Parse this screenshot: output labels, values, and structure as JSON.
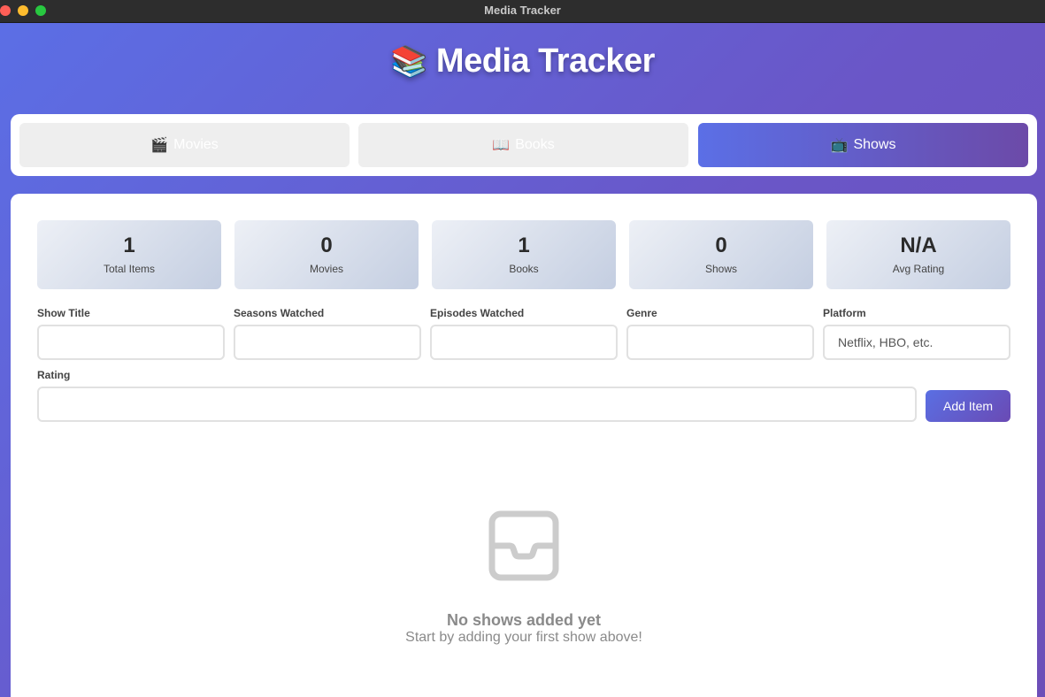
{
  "window": {
    "title": "Media Tracker"
  },
  "header": {
    "icon": "books-emoji",
    "icon_glyph": "📚",
    "title": "Media Tracker"
  },
  "tabs": [
    {
      "icon": "clapper-board-emoji",
      "icon_glyph": "🎬",
      "label": "Movies",
      "active": false
    },
    {
      "icon": "open-book-emoji",
      "icon_glyph": "📖",
      "label": "Books",
      "active": false
    },
    {
      "icon": "television-emoji",
      "icon_glyph": "📺",
      "label": "Shows",
      "active": true
    }
  ],
  "stats": [
    {
      "value": "1",
      "label": "Total Items"
    },
    {
      "value": "0",
      "label": "Movies"
    },
    {
      "value": "1",
      "label": "Books"
    },
    {
      "value": "0",
      "label": "Shows"
    },
    {
      "value": "N/A",
      "label": "Avg Rating"
    }
  ],
  "form": {
    "fields": [
      {
        "label": "Show Title",
        "value": "",
        "placeholder": ""
      },
      {
        "label": "Seasons Watched",
        "value": "",
        "placeholder": ""
      },
      {
        "label": "Episodes Watched",
        "value": "",
        "placeholder": ""
      },
      {
        "label": "Genre",
        "value": "",
        "placeholder": ""
      },
      {
        "label": "Platform",
        "value": "",
        "placeholder": "Netflix, HBO, etc."
      }
    ],
    "rating": {
      "label": "Rating",
      "value": "",
      "placeholder": ""
    },
    "add_button_label": "Add Item"
  },
  "empty_state": {
    "icon": "inbox-icon",
    "title": "No shows added yet",
    "subtitle": "Start by adding your first show above!"
  },
  "colors": {
    "background_start": "#5b6fe6",
    "background_end": "#6d4fb8",
    "tab_active_start": "#5b6fe6",
    "tab_active_end": "#6c4aa8",
    "tab_inactive": "#eeeeee",
    "empty_state": "#8a8a8a"
  }
}
